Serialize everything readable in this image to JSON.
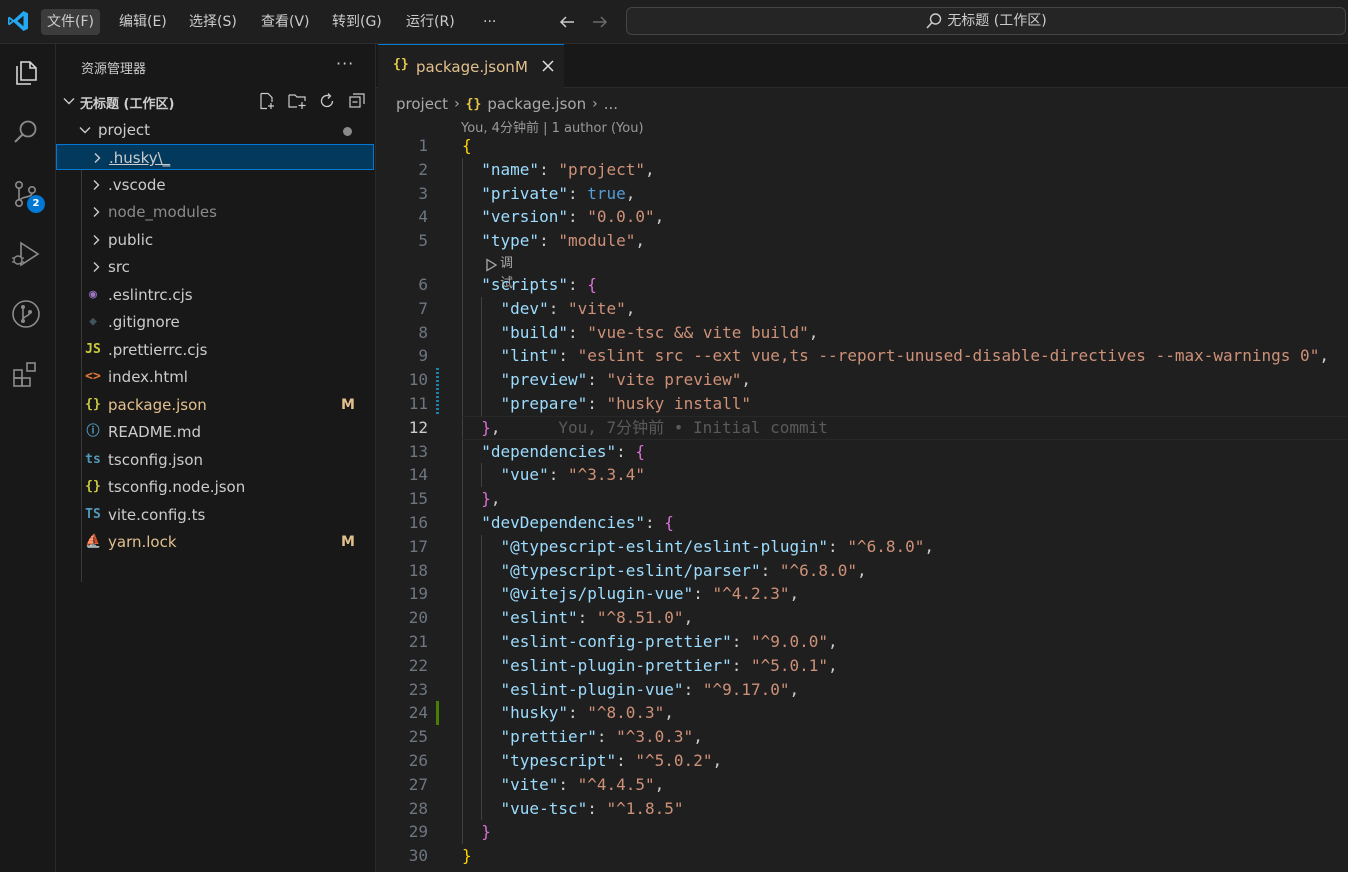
{
  "menu": {
    "items": [
      "文件(F)",
      "编辑(E)",
      "选择(S)",
      "查看(V)",
      "转到(G)",
      "运行(R)",
      "···"
    ],
    "active_index": 0
  },
  "command_center": {
    "label": "无标题 (工作区)",
    "icon": "search-icon"
  },
  "activity_bar": {
    "items": [
      "explorer-icon",
      "search-icon",
      "source-control-icon",
      "run-debug-icon",
      "git-graph-icon",
      "extensions-icon"
    ],
    "scm_badge": "2"
  },
  "explorer": {
    "title": "资源管理器",
    "more": "···",
    "workspace_name": "无标题 (工作区)",
    "project": "project",
    "files": [
      {
        "name": ".husky\\_",
        "kind": "folder",
        "icon": "chevron",
        "color": "#cccccc",
        "selected": true
      },
      {
        "name": ".vscode",
        "kind": "folder",
        "icon": "chevron",
        "color": "#cccccc"
      },
      {
        "name": "node_modules",
        "kind": "folder",
        "icon": "chevron",
        "color": "#8b8b8b"
      },
      {
        "name": "public",
        "kind": "folder",
        "icon": "chevron",
        "color": "#cccccc"
      },
      {
        "name": "src",
        "kind": "folder",
        "icon": "chevron",
        "color": "#cccccc"
      },
      {
        "name": ".eslintrc.cjs",
        "kind": "file",
        "icon": "eslint-icon",
        "glyph": "◉",
        "glyph_color": "#a074c4",
        "color": "#cccccc"
      },
      {
        "name": ".gitignore",
        "kind": "file",
        "icon": "git-icon",
        "glyph": "◆",
        "glyph_color": "#41535b",
        "color": "#cccccc"
      },
      {
        "name": ".prettierrc.cjs",
        "kind": "file",
        "icon": "js-icon",
        "glyph": "JS",
        "glyph_color": "#cbcb41",
        "color": "#cccccc"
      },
      {
        "name": "index.html",
        "kind": "file",
        "icon": "html-icon",
        "glyph": "<>",
        "glyph_color": "#e37933",
        "color": "#cccccc"
      },
      {
        "name": "package.json",
        "kind": "file",
        "icon": "json-icon",
        "glyph": "{}",
        "glyph_color": "#cbcb41",
        "color": "#e2c08d",
        "status": "M"
      },
      {
        "name": "README.md",
        "kind": "file",
        "icon": "info-icon",
        "glyph": "ⓘ",
        "glyph_color": "#519aba",
        "color": "#cccccc"
      },
      {
        "name": "tsconfig.json",
        "kind": "file",
        "icon": "ts-config-icon",
        "glyph": "ts",
        "glyph_color": "#519aba",
        "color": "#cccccc"
      },
      {
        "name": "tsconfig.node.json",
        "kind": "file",
        "icon": "json-icon",
        "glyph": "{}",
        "glyph_color": "#cbcb41",
        "color": "#cccccc"
      },
      {
        "name": "vite.config.ts",
        "kind": "file",
        "icon": "ts-icon",
        "glyph": "TS",
        "glyph_color": "#519aba",
        "color": "#cccccc"
      },
      {
        "name": "yarn.lock",
        "kind": "file",
        "icon": "yarn-icon",
        "glyph": "⛵",
        "glyph_color": "#519aba",
        "color": "#e2c08d",
        "status": "M"
      }
    ]
  },
  "editor": {
    "tab": {
      "label": "package.json",
      "status": "M",
      "icon": "{}"
    },
    "breadcrumb": [
      "project",
      "package.json",
      "..."
    ],
    "author_lens": "You, 4分钟前 | 1 author (You)",
    "run_lens": "调试",
    "blame": "You, 7分钟前 • Initial commit",
    "current_line": 12,
    "lines": [
      {
        "n": "1",
        "t": [
          [
            "br1",
            "{"
          ]
        ]
      },
      {
        "n": "2",
        "t": [
          [
            "p",
            "  "
          ],
          [
            "k",
            "\"name\""
          ],
          [
            "p",
            ": "
          ],
          [
            "s",
            "\"project\""
          ],
          [
            "p",
            ","
          ]
        ]
      },
      {
        "n": "3",
        "t": [
          [
            "p",
            "  "
          ],
          [
            "k",
            "\"private\""
          ],
          [
            "p",
            ": "
          ],
          [
            "b",
            "true"
          ],
          [
            "p",
            ","
          ]
        ]
      },
      {
        "n": "4",
        "t": [
          [
            "p",
            "  "
          ],
          [
            "k",
            "\"version\""
          ],
          [
            "p",
            ": "
          ],
          [
            "s",
            "\"0.0.0\""
          ],
          [
            "p",
            ","
          ]
        ]
      },
      {
        "n": "5",
        "t": [
          [
            "p",
            "  "
          ],
          [
            "k",
            "\"type\""
          ],
          [
            "p",
            ": "
          ],
          [
            "s",
            "\"module\""
          ],
          [
            "p",
            ","
          ]
        ]
      },
      {
        "n": "6",
        "t": [
          [
            "p",
            "  "
          ],
          [
            "k",
            "\"scripts\""
          ],
          [
            "p",
            ": "
          ],
          [
            "br2",
            "{"
          ]
        ]
      },
      {
        "n": "7",
        "t": [
          [
            "p",
            "    "
          ],
          [
            "k",
            "\"dev\""
          ],
          [
            "p",
            ": "
          ],
          [
            "s",
            "\"vite\""
          ],
          [
            "p",
            ","
          ]
        ]
      },
      {
        "n": "8",
        "t": [
          [
            "p",
            "    "
          ],
          [
            "k",
            "\"build\""
          ],
          [
            "p",
            ": "
          ],
          [
            "s",
            "\"vue-tsc && vite build\""
          ],
          [
            "p",
            ","
          ]
        ]
      },
      {
        "n": "9",
        "t": [
          [
            "p",
            "    "
          ],
          [
            "k",
            "\"lint\""
          ],
          [
            "p",
            ": "
          ],
          [
            "s",
            "\"eslint src --ext vue,ts --report-unused-disable-directives --max-warnings 0\""
          ],
          [
            "p",
            ","
          ]
        ]
      },
      {
        "n": "10",
        "t": [
          [
            "p",
            "    "
          ],
          [
            "k",
            "\"preview\""
          ],
          [
            "p",
            ": "
          ],
          [
            "s",
            "\"vite preview\""
          ],
          [
            "p",
            ","
          ]
        ]
      },
      {
        "n": "11",
        "t": [
          [
            "p",
            "    "
          ],
          [
            "k",
            "\"prepare\""
          ],
          [
            "p",
            ": "
          ],
          [
            "s",
            "\"husky install\""
          ]
        ]
      },
      {
        "n": "12",
        "t": [
          [
            "p",
            "  "
          ],
          [
            "br2",
            "}"
          ],
          [
            "p",
            ","
          ]
        ]
      },
      {
        "n": "13",
        "t": [
          [
            "p",
            "  "
          ],
          [
            "k",
            "\"dependencies\""
          ],
          [
            "p",
            ": "
          ],
          [
            "br2",
            "{"
          ]
        ]
      },
      {
        "n": "14",
        "t": [
          [
            "p",
            "    "
          ],
          [
            "k",
            "\"vue\""
          ],
          [
            "p",
            ": "
          ],
          [
            "s",
            "\"^3.3.4\""
          ]
        ]
      },
      {
        "n": "15",
        "t": [
          [
            "p",
            "  "
          ],
          [
            "br2",
            "}"
          ],
          [
            "p",
            ","
          ]
        ]
      },
      {
        "n": "16",
        "t": [
          [
            "p",
            "  "
          ],
          [
            "k",
            "\"devDependencies\""
          ],
          [
            "p",
            ": "
          ],
          [
            "br2",
            "{"
          ]
        ]
      },
      {
        "n": "17",
        "t": [
          [
            "p",
            "    "
          ],
          [
            "k",
            "\"@typescript-eslint/eslint-plugin\""
          ],
          [
            "p",
            ": "
          ],
          [
            "s",
            "\"^6.8.0\""
          ],
          [
            "p",
            ","
          ]
        ]
      },
      {
        "n": "18",
        "t": [
          [
            "p",
            "    "
          ],
          [
            "k",
            "\"@typescript-eslint/parser\""
          ],
          [
            "p",
            ": "
          ],
          [
            "s",
            "\"^6.8.0\""
          ],
          [
            "p",
            ","
          ]
        ]
      },
      {
        "n": "19",
        "t": [
          [
            "p",
            "    "
          ],
          [
            "k",
            "\"@vitejs/plugin-vue\""
          ],
          [
            "p",
            ": "
          ],
          [
            "s",
            "\"^4.2.3\""
          ],
          [
            "p",
            ","
          ]
        ]
      },
      {
        "n": "20",
        "t": [
          [
            "p",
            "    "
          ],
          [
            "k",
            "\"eslint\""
          ],
          [
            "p",
            ": "
          ],
          [
            "s",
            "\"^8.51.0\""
          ],
          [
            "p",
            ","
          ]
        ]
      },
      {
        "n": "21",
        "t": [
          [
            "p",
            "    "
          ],
          [
            "k",
            "\"eslint-config-prettier\""
          ],
          [
            "p",
            ": "
          ],
          [
            "s",
            "\"^9.0.0\""
          ],
          [
            "p",
            ","
          ]
        ]
      },
      {
        "n": "22",
        "t": [
          [
            "p",
            "    "
          ],
          [
            "k",
            "\"eslint-plugin-prettier\""
          ],
          [
            "p",
            ": "
          ],
          [
            "s",
            "\"^5.0.1\""
          ],
          [
            "p",
            ","
          ]
        ]
      },
      {
        "n": "23",
        "t": [
          [
            "p",
            "    "
          ],
          [
            "k",
            "\"eslint-plugin-vue\""
          ],
          [
            "p",
            ": "
          ],
          [
            "s",
            "\"^9.17.0\""
          ],
          [
            "p",
            ","
          ]
        ]
      },
      {
        "n": "24",
        "t": [
          [
            "p",
            "    "
          ],
          [
            "k",
            "\"husky\""
          ],
          [
            "p",
            ": "
          ],
          [
            "s",
            "\"^8.0.3\""
          ],
          [
            "p",
            ","
          ]
        ]
      },
      {
        "n": "25",
        "t": [
          [
            "p",
            "    "
          ],
          [
            "k",
            "\"prettier\""
          ],
          [
            "p",
            ": "
          ],
          [
            "s",
            "\"^3.0.3\""
          ],
          [
            "p",
            ","
          ]
        ]
      },
      {
        "n": "26",
        "t": [
          [
            "p",
            "    "
          ],
          [
            "k",
            "\"typescript\""
          ],
          [
            "p",
            ": "
          ],
          [
            "s",
            "\"^5.0.2\""
          ],
          [
            "p",
            ","
          ]
        ]
      },
      {
        "n": "27",
        "t": [
          [
            "p",
            "    "
          ],
          [
            "k",
            "\"vite\""
          ],
          [
            "p",
            ": "
          ],
          [
            "s",
            "\"^4.4.5\""
          ],
          [
            "p",
            ","
          ]
        ]
      },
      {
        "n": "28",
        "t": [
          [
            "p",
            "    "
          ],
          [
            "k",
            "\"vue-tsc\""
          ],
          [
            "p",
            ": "
          ],
          [
            "s",
            "\"^1.8.5\""
          ]
        ]
      },
      {
        "n": "29",
        "t": [
          [
            "p",
            "  "
          ],
          [
            "br2",
            "}"
          ]
        ]
      },
      {
        "n": "30",
        "t": [
          [
            "br1",
            "}"
          ]
        ]
      }
    ]
  },
  "colors": {
    "accent": "#0078d4",
    "modified": "#e2c08d",
    "gutter_added": "#487e02",
    "gutter_modified": "#1b81a8"
  }
}
